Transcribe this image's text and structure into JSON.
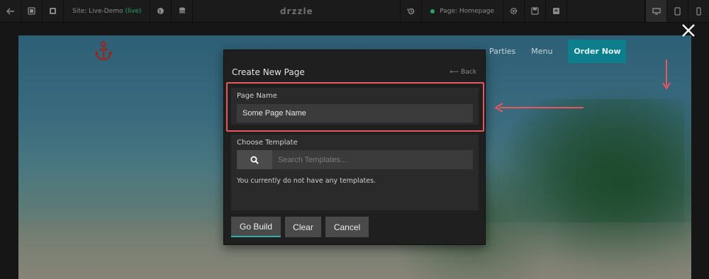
{
  "toolbar": {
    "site_label": "Site: Live-Demo",
    "site_status": "(live)",
    "brand": "drzzle",
    "page_label": "Page: Homepage",
    "icons": [
      "back-arrow-icon",
      "pages-icon",
      "copy-icon",
      "globe-icon",
      "database-icon",
      "history-icon",
      "gear-icon",
      "save-icon",
      "publish-icon",
      "desktop-icon",
      "tablet-icon",
      "mobile-icon"
    ],
    "status_color": "#27a66b"
  },
  "site_preview": {
    "nav": [
      "Parties",
      "Menu"
    ],
    "cta": "Order Now",
    "accent_color": "#0d7f8c",
    "logo_icon": "anchor-icon"
  },
  "modal": {
    "title": "Create New Page",
    "back_label": "Back",
    "page_name_label": "Page Name",
    "page_name_value": "Some Page Name",
    "template_label": "Choose Template",
    "search_placeholder": "Search Templates...",
    "empty_message": "You currently do not have any templates.",
    "buttons": {
      "go_build": "Go Build",
      "clear": "Clear",
      "cancel": "Cancel"
    }
  },
  "annotation_color": "#e8565f"
}
